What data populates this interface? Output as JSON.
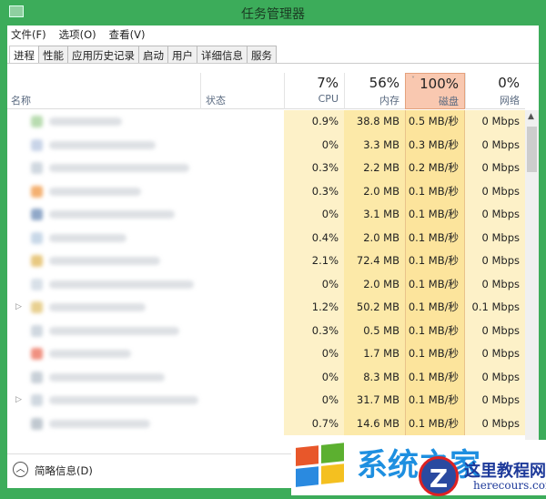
{
  "window": {
    "title": "任务管理器"
  },
  "menu": [
    "文件(F)",
    "选项(O)",
    "查看(V)"
  ],
  "tabs": [
    "进程",
    "性能",
    "应用历史记录",
    "启动",
    "用户",
    "详细信息",
    "服务"
  ],
  "columns": {
    "name": "名称",
    "status": "状态",
    "cpu": {
      "pct": "7%",
      "label": "CPU"
    },
    "memory": {
      "pct": "56%",
      "label": "内存"
    },
    "disk": {
      "pct": "100%",
      "label": "磁盘"
    },
    "network": {
      "pct": "0%",
      "label": "网络"
    }
  },
  "rows": [
    {
      "cpu": "0.9%",
      "mem": "38.8 MB",
      "disk": "0.5 MB/秒",
      "net": "0 Mbps"
    },
    {
      "cpu": "0%",
      "mem": "3.3 MB",
      "disk": "0.3 MB/秒",
      "net": "0 Mbps"
    },
    {
      "cpu": "0.3%",
      "mem": "2.2 MB",
      "disk": "0.2 MB/秒",
      "net": "0 Mbps"
    },
    {
      "cpu": "0.3%",
      "mem": "2.0 MB",
      "disk": "0.1 MB/秒",
      "net": "0 Mbps"
    },
    {
      "cpu": "0%",
      "mem": "3.1 MB",
      "disk": "0.1 MB/秒",
      "net": "0 Mbps"
    },
    {
      "cpu": "0.4%",
      "mem": "2.0 MB",
      "disk": "0.1 MB/秒",
      "net": "0 Mbps"
    },
    {
      "cpu": "2.1%",
      "mem": "72.4 MB",
      "disk": "0.1 MB/秒",
      "net": "0 Mbps"
    },
    {
      "cpu": "0%",
      "mem": "2.0 MB",
      "disk": "0.1 MB/秒",
      "net": "0 Mbps"
    },
    {
      "cpu": "1.2%",
      "mem": "50.2 MB",
      "disk": "0.1 MB/秒",
      "net": "0.1 Mbps",
      "expandable": true
    },
    {
      "cpu": "0.3%",
      "mem": "0.5 MB",
      "disk": "0.1 MB/秒",
      "net": "0 Mbps"
    },
    {
      "cpu": "0%",
      "mem": "1.7 MB",
      "disk": "0.1 MB/秒",
      "net": "0 Mbps"
    },
    {
      "cpu": "0%",
      "mem": "8.3 MB",
      "disk": "0.1 MB/秒",
      "net": "0 Mbps"
    },
    {
      "cpu": "0%",
      "mem": "31.7 MB",
      "disk": "0.1 MB/秒",
      "net": "0 Mbps",
      "expandable": true
    },
    {
      "cpu": "0.7%",
      "mem": "14.6 MB",
      "disk": "0.1 MB/秒",
      "net": "0 Mbps"
    }
  ],
  "footer": {
    "fewer_details": "简略信息(D)"
  },
  "watermark": {
    "logo_text": "系统之家",
    "site_cn": "这里教程网",
    "site_en": "herecours.com"
  }
}
